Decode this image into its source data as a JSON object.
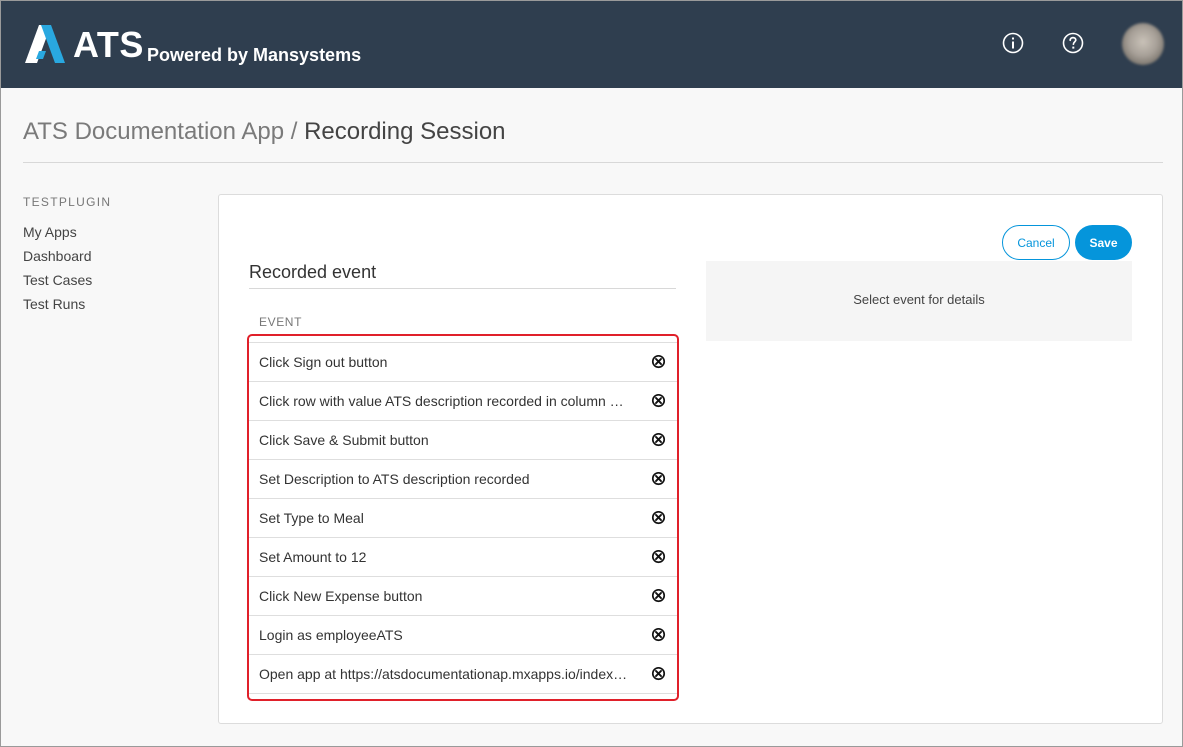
{
  "header": {
    "logo_text": "ATS",
    "logo_subtitle": "Powered by Mansystems",
    "info_icon": "info-icon",
    "help_icon": "help-icon",
    "bg_color": "#2f3e4f",
    "accent_color": "#29a8e0"
  },
  "breadcrumb": {
    "app": "ATS Documentation App",
    "separator": "/",
    "current": "Recording Session"
  },
  "sidebar": {
    "heading": "TESTPLUGIN",
    "items": [
      {
        "label": "My Apps"
      },
      {
        "label": "Dashboard"
      },
      {
        "label": "Test Cases"
      },
      {
        "label": "Test Runs"
      }
    ]
  },
  "toolbar": {
    "cancel_label": "Cancel",
    "save_label": "Save",
    "primary_color": "#0595db"
  },
  "recorded": {
    "title": "Recorded event",
    "column_header": "EVENT",
    "remove_icon": "remove-circle-icon",
    "highlight_color": "#e0202a",
    "events": [
      {
        "label": "Click Sign out button"
      },
      {
        "label": "Click row with value ATS description recorded in column column"
      },
      {
        "label": "Click Save & Submit button"
      },
      {
        "label": "Set Description to ATS description recorded"
      },
      {
        "label": "Set Type to Meal"
      },
      {
        "label": "Set Amount to 12"
      },
      {
        "label": "Click New Expense button"
      },
      {
        "label": "Login as employeeATS"
      },
      {
        "label": "Open app at https://atsdocumentationap.mxapps.io/index.html"
      }
    ]
  },
  "details": {
    "placeholder": "Select event for details"
  }
}
